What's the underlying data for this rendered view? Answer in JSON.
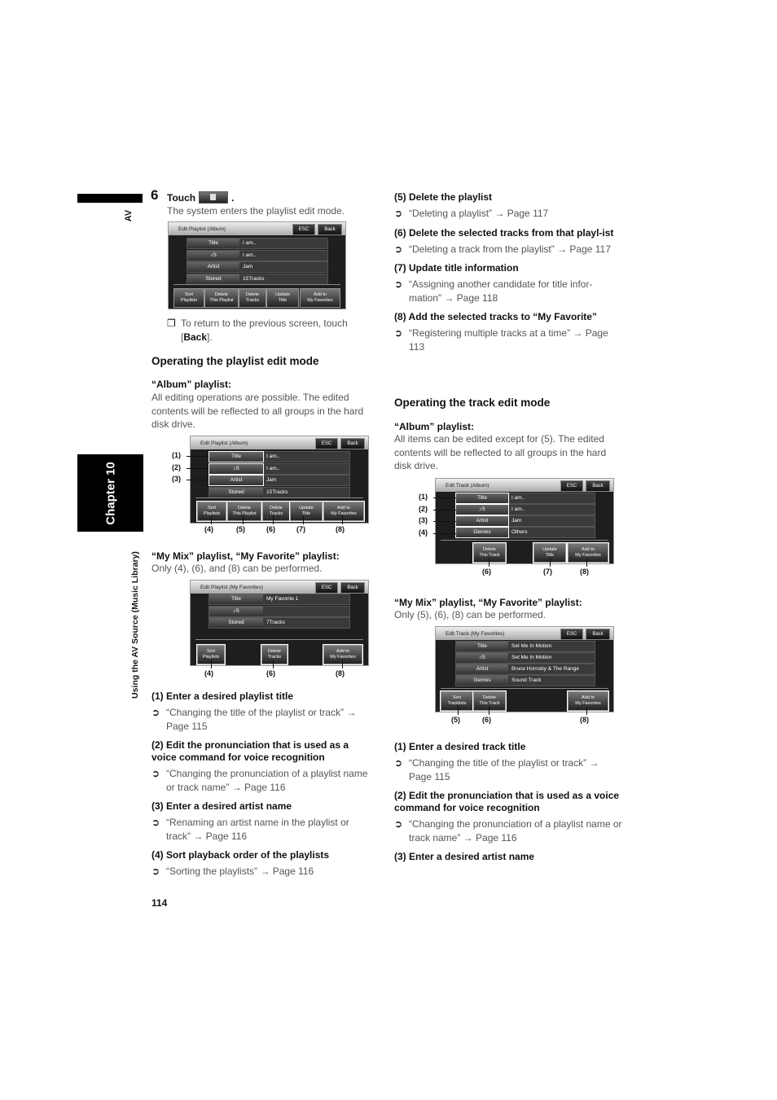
{
  "sidebar": {
    "section_tag": "AV",
    "chapter": "Chapter 10",
    "running_title": "Using the AV Source (Music Library)"
  },
  "step": {
    "number": "6",
    "touch_label": "Touch",
    "touch_icon": "playlist-edit-icon",
    "after": ".",
    "description": "The system enters the playlist edit mode.",
    "note_bullet": "❐",
    "note_text_1": "To return to the previous screen, touch",
    "note_text_2_open": "[",
    "note_text_2_bold": "Back",
    "note_text_2_close": "]."
  },
  "screen1": {
    "title": "Edit Playlist (Album)",
    "esc": "ESC",
    "back": "Back",
    "rows": [
      {
        "key": "Title",
        "value": "I am.."
      },
      {
        "key": "♪S",
        "value": "I am.."
      },
      {
        "key": "Artist",
        "value": "Jam"
      },
      {
        "key": "Stored",
        "value": "15Tracks"
      }
    ],
    "buttons": [
      "Sort\nPlaylists",
      "Delete\nThis Playlist",
      "Delete\nTracks",
      "Update\nTitle",
      "Add to\nMy Favorites"
    ]
  },
  "playlist_mode": {
    "heading": "Operating the playlist edit mode",
    "album_heading": "“Album” playlist:",
    "album_text": "All editing operations are possible. The edited contents will be reflected to all groups in the hard disk drive.",
    "mymix_heading": "“My Mix” playlist, “My Favorite” playlist:",
    "mymix_text": "Only (4), (6), and (8) can be performed."
  },
  "screen2": {
    "title": "Edit Playlist (Album)",
    "esc": "ESC",
    "back": "Back",
    "rows": [
      {
        "key": "Title",
        "value": "I am.."
      },
      {
        "key": "♪S",
        "value": "I am.."
      },
      {
        "key": "Artist",
        "value": "Jam"
      },
      {
        "key": "Stored",
        "value": "15Tracks"
      }
    ],
    "buttons": [
      "Sort\nPlaylists",
      "Delete\nThis Playlist",
      "Delete\nTracks",
      "Update\nTitle",
      "Add to\nMy Favorites"
    ],
    "callouts_left": [
      "(1)",
      "(2)",
      "(3)"
    ],
    "callouts_bottom": [
      "(4)",
      "(5)",
      "(6)",
      "(7)",
      "(8)"
    ]
  },
  "screen3": {
    "title": "Edit Playlist (My Favorites)",
    "esc": "ESC",
    "back": "Back",
    "rows": [
      {
        "key": "Title",
        "value": "My Favorite 1"
      },
      {
        "key": "♪S",
        "value": ""
      },
      {
        "key": "Stored",
        "value": "7Tracks"
      }
    ],
    "buttons": [
      "Sort\nPlaylists",
      "Delete\nTracks",
      "Add to\nMy Favorites"
    ],
    "callouts_bottom": [
      "(4)",
      "(6)",
      "(8)"
    ]
  },
  "playlist_items": [
    {
      "heading": "(1) Enter a desired playlist title",
      "ref": "“Changing the title of the playlist or track” → Page 115"
    },
    {
      "heading": "(2) Edit the pronunciation that is used as a voice command for voice recognition",
      "ref": "“Changing the pronunciation of a playlist name or track name” → Page 116"
    },
    {
      "heading": "(3) Enter a desired artist name",
      "ref": "“Renaming an artist name in the playlist or track” → Page 116"
    },
    {
      "heading": "(4) Sort playback order of the playlists",
      "ref": "“Sorting the playlists” → Page 116"
    },
    {
      "heading": "(5) Delete the playlist",
      "ref": "“Deleting a playlist” → Page 117"
    },
    {
      "heading": "(6) Delete the selected tracks from that playl-ist",
      "ref": "“Deleting a track from the playlist” → Page 117"
    },
    {
      "heading": "(7) Update title information",
      "ref": "“Assigning another candidate for title infor-mation” → Page 118"
    },
    {
      "heading": "(8) Add the selected tracks to “My Favorite”",
      "ref": "“Registering multiple tracks at a time” → Page 113"
    }
  ],
  "ref_marker": "➲",
  "track_mode": {
    "heading": "Operating the track edit mode",
    "album_heading": "“Album” playlist:",
    "album_text": "All items can be edited except for (5). The edited contents will be reflected to all groups in the hard disk drive.",
    "mymix_heading": "“My Mix” playlist, “My Favorite” playlist:",
    "mymix_text": "Only (5), (6), (8) can be performed."
  },
  "screen4": {
    "title": "Edit Track (Album)",
    "esc": "ESC",
    "back": "Back",
    "rows": [
      {
        "key": "Title",
        "value": "I am.."
      },
      {
        "key": "♪S",
        "value": "I am.."
      },
      {
        "key": "Artist",
        "value": "Jam"
      },
      {
        "key": "Genres",
        "value": "Others"
      }
    ],
    "buttons": [
      "Delete\nThis Track",
      "Update\nTitle",
      "Add to\nMy Favorites"
    ],
    "callouts_left": [
      "(1)",
      "(2)",
      "(3)",
      "(4)"
    ],
    "callouts_bottom": [
      "(6)",
      "(7)",
      "(8)"
    ]
  },
  "screen5": {
    "title": "Edit Track (My Favorites)",
    "esc": "ESC",
    "back": "Back",
    "rows": [
      {
        "key": "Title",
        "value": "Set Me In Motion"
      },
      {
        "key": "♪S",
        "value": "Set Me In Motion"
      },
      {
        "key": "Artist",
        "value": "Bruce Hornsby & The Range"
      },
      {
        "key": "Genres",
        "value": "Sound Track"
      }
    ],
    "buttons": [
      "Sort\nTracklists",
      "Delete\nThis Track",
      "Add to\nMy Favorites"
    ],
    "callouts_bottom": [
      "(5)",
      "(6)",
      "(8)"
    ]
  },
  "track_items": [
    {
      "heading": "(1) Enter a desired track title",
      "ref": "“Changing the title of the playlist or track” → Page 115"
    },
    {
      "heading": "(2) Edit the pronunciation that is used as a voice command for voice recognition",
      "ref": "“Changing the pronunciation of a playlist name or track name” → Page 116"
    },
    {
      "heading": "(3) Enter a desired artist name"
    }
  ],
  "page_number": "114"
}
